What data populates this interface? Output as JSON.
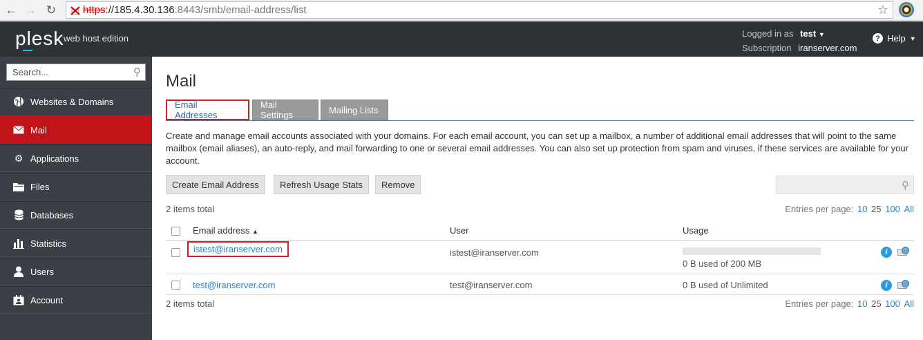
{
  "browser": {
    "url_protocol": "https",
    "url_host": "://185.4.30.136",
    "url_rest": ":8443/smb/email-address/list"
  },
  "header": {
    "logo": "plesk",
    "edition": "web host edition",
    "logged_in_label": "Logged in as",
    "logged_in_user": "test",
    "subscription_label": "Subscription",
    "subscription_value": "iranserver.com",
    "help_label": "Help"
  },
  "sidebar": {
    "search_placeholder": "Search...",
    "items": [
      {
        "label": "Websites & Domains",
        "icon": "globe-icon"
      },
      {
        "label": "Mail",
        "icon": "envelope-icon",
        "active": true
      },
      {
        "label": "Applications",
        "icon": "gear-icon"
      },
      {
        "label": "Files",
        "icon": "folder-icon"
      },
      {
        "label": "Databases",
        "icon": "database-icon"
      },
      {
        "label": "Statistics",
        "icon": "bar-chart-icon"
      },
      {
        "label": "Users",
        "icon": "user-icon"
      },
      {
        "label": "Account",
        "icon": "account-icon"
      }
    ]
  },
  "main": {
    "title": "Mail",
    "tabs": [
      {
        "label": "Email Addresses",
        "active": true
      },
      {
        "label": "Mail Settings"
      },
      {
        "label": "Mailing Lists"
      }
    ],
    "description": "Create and manage email accounts associated with your domains. For each email account, you can set up a mailbox, a number of additional email addresses that will point to the same mailbox (email aliases), an auto-reply, and mail forwarding to one or several email addresses. You can also set up protection from spam and viruses, if these services are available for your account.",
    "buttons": {
      "create": "Create Email Address",
      "refresh": "Refresh Usage Stats",
      "remove": "Remove"
    },
    "items_total": "2 items total",
    "entries_per_page_label": "Entries per page:",
    "page_sizes": [
      "10",
      "25",
      "100",
      "All"
    ],
    "columns": {
      "email": "Email address",
      "user": "User",
      "usage": "Usage"
    },
    "rows": [
      {
        "email": "istest@iranserver.com",
        "user": "istest@iranserver.com",
        "usage": "0 B used of 200 MB",
        "usage_fraction": 0
      },
      {
        "email": "test@iranserver.com",
        "user": "test@iranserver.com",
        "usage": "0 B used of Unlimited"
      }
    ]
  },
  "colors": {
    "header_bg": "#2e3136",
    "sidebar_bg": "#3c4046",
    "active_red": "#c0131a",
    "link_blue": "#2a84c5"
  }
}
